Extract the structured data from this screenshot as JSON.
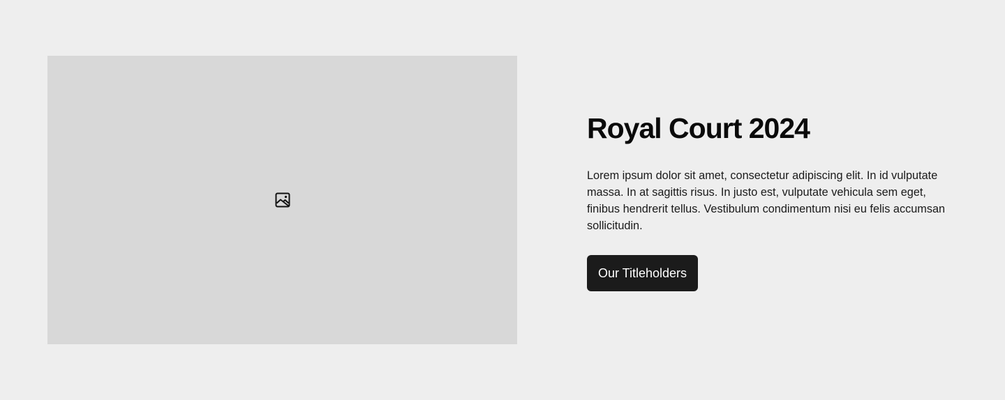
{
  "media": {
    "icon": "image-icon"
  },
  "hero": {
    "title": "Royal Court 2024",
    "description": "Lorem ipsum dolor sit amet, consectetur adipiscing elit. In id vulputate massa. In at sagittis risus. In justo est, vulputate vehicula sem eget, finibus hendrerit tellus. Vestibulum condimentum nisi eu felis accumsan sollicitudin.",
    "button_label": "Our Titleholders"
  },
  "colors": {
    "background": "#eeeeee",
    "placeholder": "#d8d8d8",
    "button": "#1b1b1b",
    "button_text": "#ffffff"
  }
}
